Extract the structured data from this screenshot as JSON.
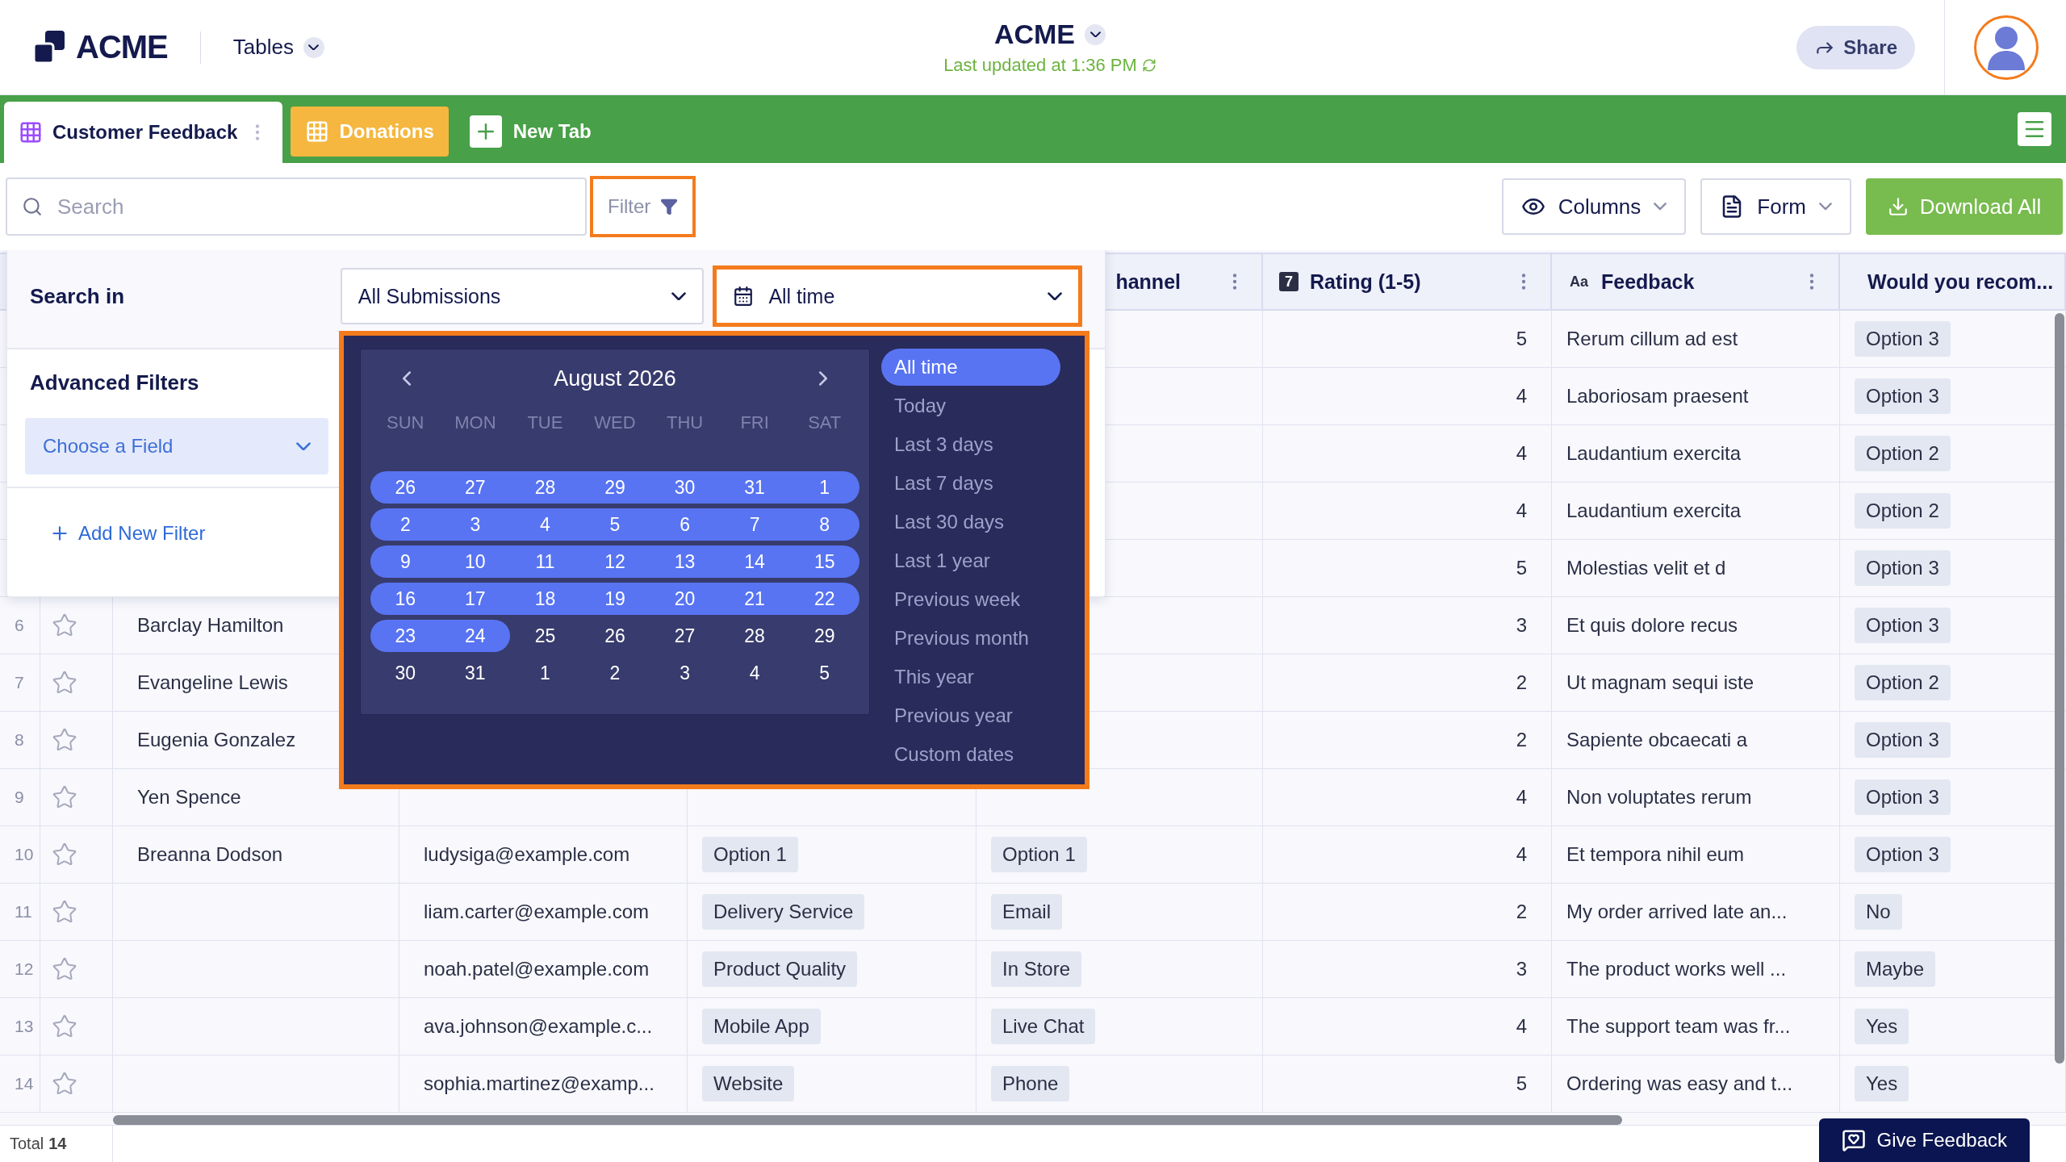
{
  "header": {
    "logo": "ACME",
    "section": "Tables",
    "title": "ACME",
    "last_updated": "Last updated at 1:36 PM",
    "share": "Share"
  },
  "tabs": [
    {
      "label": "Customer Feedback",
      "selected": true,
      "color": "#9c4dff"
    },
    {
      "label": "Donations",
      "selected": false,
      "color": "#f5b73f"
    }
  ],
  "new_tab": "New Tab",
  "toolbar": {
    "search_placeholder": "Search",
    "filter": "Filter",
    "columns": "Columns",
    "form": "Form",
    "download": "Download All"
  },
  "filter_panel": {
    "search_in_label": "Search in",
    "scope": "All Submissions",
    "period": "All time",
    "advanced_label": "Advanced Filters",
    "field_select": "Choose a Field",
    "add_filter": "Add New Filter"
  },
  "calendar": {
    "month": "August 2026",
    "weekdays": [
      "SUN",
      "MON",
      "TUE",
      "WED",
      "THU",
      "FRI",
      "SAT"
    ],
    "weeks": [
      [
        {
          "day": "26",
          "selected": true
        },
        {
          "day": "27",
          "selected": true
        },
        {
          "day": "28",
          "selected": true
        },
        {
          "day": "29",
          "selected": true
        },
        {
          "day": "30",
          "selected": true
        },
        {
          "day": "31",
          "selected": true
        },
        {
          "day": "1",
          "selected": true
        }
      ],
      [
        {
          "day": "2",
          "selected": true
        },
        {
          "day": "3",
          "selected": true
        },
        {
          "day": "4",
          "selected": true
        },
        {
          "day": "5",
          "selected": true
        },
        {
          "day": "6",
          "selected": true
        },
        {
          "day": "7",
          "selected": true
        },
        {
          "day": "8",
          "selected": true
        }
      ],
      [
        {
          "day": "9",
          "selected": true
        },
        {
          "day": "10",
          "selected": true
        },
        {
          "day": "11",
          "selected": true
        },
        {
          "day": "12",
          "selected": true
        },
        {
          "day": "13",
          "selected": true
        },
        {
          "day": "14",
          "selected": true
        },
        {
          "day": "15",
          "selected": true
        }
      ],
      [
        {
          "day": "16",
          "selected": true
        },
        {
          "day": "17",
          "selected": true
        },
        {
          "day": "18",
          "selected": true
        },
        {
          "day": "19",
          "selected": true
        },
        {
          "day": "20",
          "selected": true
        },
        {
          "day": "21",
          "selected": true
        },
        {
          "day": "22",
          "selected": true
        }
      ],
      [
        {
          "day": "23",
          "selected": true
        },
        {
          "day": "24",
          "selected": true
        },
        {
          "day": "25",
          "selected": false
        },
        {
          "day": "26",
          "selected": false
        },
        {
          "day": "27",
          "selected": false
        },
        {
          "day": "28",
          "selected": false
        },
        {
          "day": "29",
          "selected": false
        }
      ],
      [
        {
          "day": "30",
          "selected": false
        },
        {
          "day": "31",
          "selected": false
        },
        {
          "day": "1",
          "selected": false
        },
        {
          "day": "2",
          "selected": false
        },
        {
          "day": "3",
          "selected": false
        },
        {
          "day": "4",
          "selected": false
        },
        {
          "day": "5",
          "selected": false
        }
      ]
    ],
    "ranges": [
      {
        "label": "All time",
        "selected": true
      },
      {
        "label": "Today",
        "selected": false
      },
      {
        "label": "Last 3 days",
        "selected": false
      },
      {
        "label": "Last 7 days",
        "selected": false
      },
      {
        "label": "Last 30 days",
        "selected": false
      },
      {
        "label": "Last 1 year",
        "selected": false
      },
      {
        "label": "Previous week",
        "selected": false
      },
      {
        "label": "Previous month",
        "selected": false
      },
      {
        "label": "This year",
        "selected": false
      },
      {
        "label": "Previous year",
        "selected": false
      },
      {
        "label": "Custom dates",
        "selected": false
      }
    ]
  },
  "table": {
    "columns": [
      {
        "label": "hannel",
        "kind": "plain",
        "menu": true
      },
      {
        "label": "Rating (1-5)",
        "kind": "number",
        "icon_label": "7",
        "menu": true
      },
      {
        "label": "Feedback",
        "kind": "text",
        "icon_label": "Aa",
        "menu": true
      },
      {
        "label": "Would you recom...",
        "kind": "tag",
        "menu": false
      }
    ],
    "rows": [
      {
        "rating": "5",
        "feedback": "Rerum cillum ad est",
        "recommend": "Option 3"
      },
      {
        "rating": "4",
        "feedback": "Laboriosam praesent",
        "recommend": "Option 3"
      },
      {
        "rating": "4",
        "feedback": "Laudantium exercita",
        "recommend": "Option 2"
      },
      {
        "rating": "4",
        "feedback": "Laudantium exercita",
        "recommend": "Option 2"
      },
      {
        "rating": "5",
        "feedback": "Molestias velit et d",
        "recommend": "Option 3"
      },
      {
        "number": "6",
        "starred": false,
        "name": "Barclay Hamilton",
        "rating": "3",
        "feedback": "Et quis dolore recus",
        "recommend": "Option 3"
      },
      {
        "number": "7",
        "starred": false,
        "name": "Evangeline Lewis",
        "rating": "2",
        "feedback": "Ut magnam sequi iste",
        "recommend": "Option 2"
      },
      {
        "number": "8",
        "starred": false,
        "name": "Eugenia Gonzalez",
        "rating": "2",
        "feedback": "Sapiente obcaecati a",
        "recommend": "Option 3"
      },
      {
        "number": "9",
        "starred": false,
        "name": "Yen Spence",
        "rating": "4",
        "feedback": "Non voluptates rerum",
        "recommend": "Option 3"
      },
      {
        "number": "10",
        "starred": false,
        "name": "Breanna Dodson",
        "email": "ludysiga@example.com",
        "column_3": "Option 1",
        "column_4": "Option 1",
        "rating": "4",
        "feedback": "Et tempora nihil eum",
        "recommend": "Option 3"
      },
      {
        "number": "11",
        "starred": false,
        "email": "liam.carter@example.com",
        "column_3": "Delivery Service",
        "column_4": "Email",
        "rating": "2",
        "feedback": "My order arrived late an...",
        "recommend": "No"
      },
      {
        "number": "12",
        "starred": false,
        "email": "noah.patel@example.com",
        "column_3": "Product Quality",
        "column_4": "In Store",
        "rating": "3",
        "feedback": "The product works well ...",
        "recommend": "Maybe"
      },
      {
        "number": "13",
        "starred": false,
        "email": "ava.johnson@example.c...",
        "column_3": "Mobile App",
        "column_4": "Live Chat",
        "rating": "4",
        "feedback": "The support team was fr...",
        "recommend": "Yes"
      },
      {
        "number": "14",
        "starred": false,
        "email": "sophia.martinez@examp...",
        "column_3": "Website",
        "column_4": "Phone",
        "rating": "5",
        "feedback": "Ordering was easy and t...",
        "recommend": "Yes"
      }
    ]
  },
  "footer": {
    "total_label": "Total",
    "total_count": "14"
  },
  "feedback_button": "Give Feedback"
}
